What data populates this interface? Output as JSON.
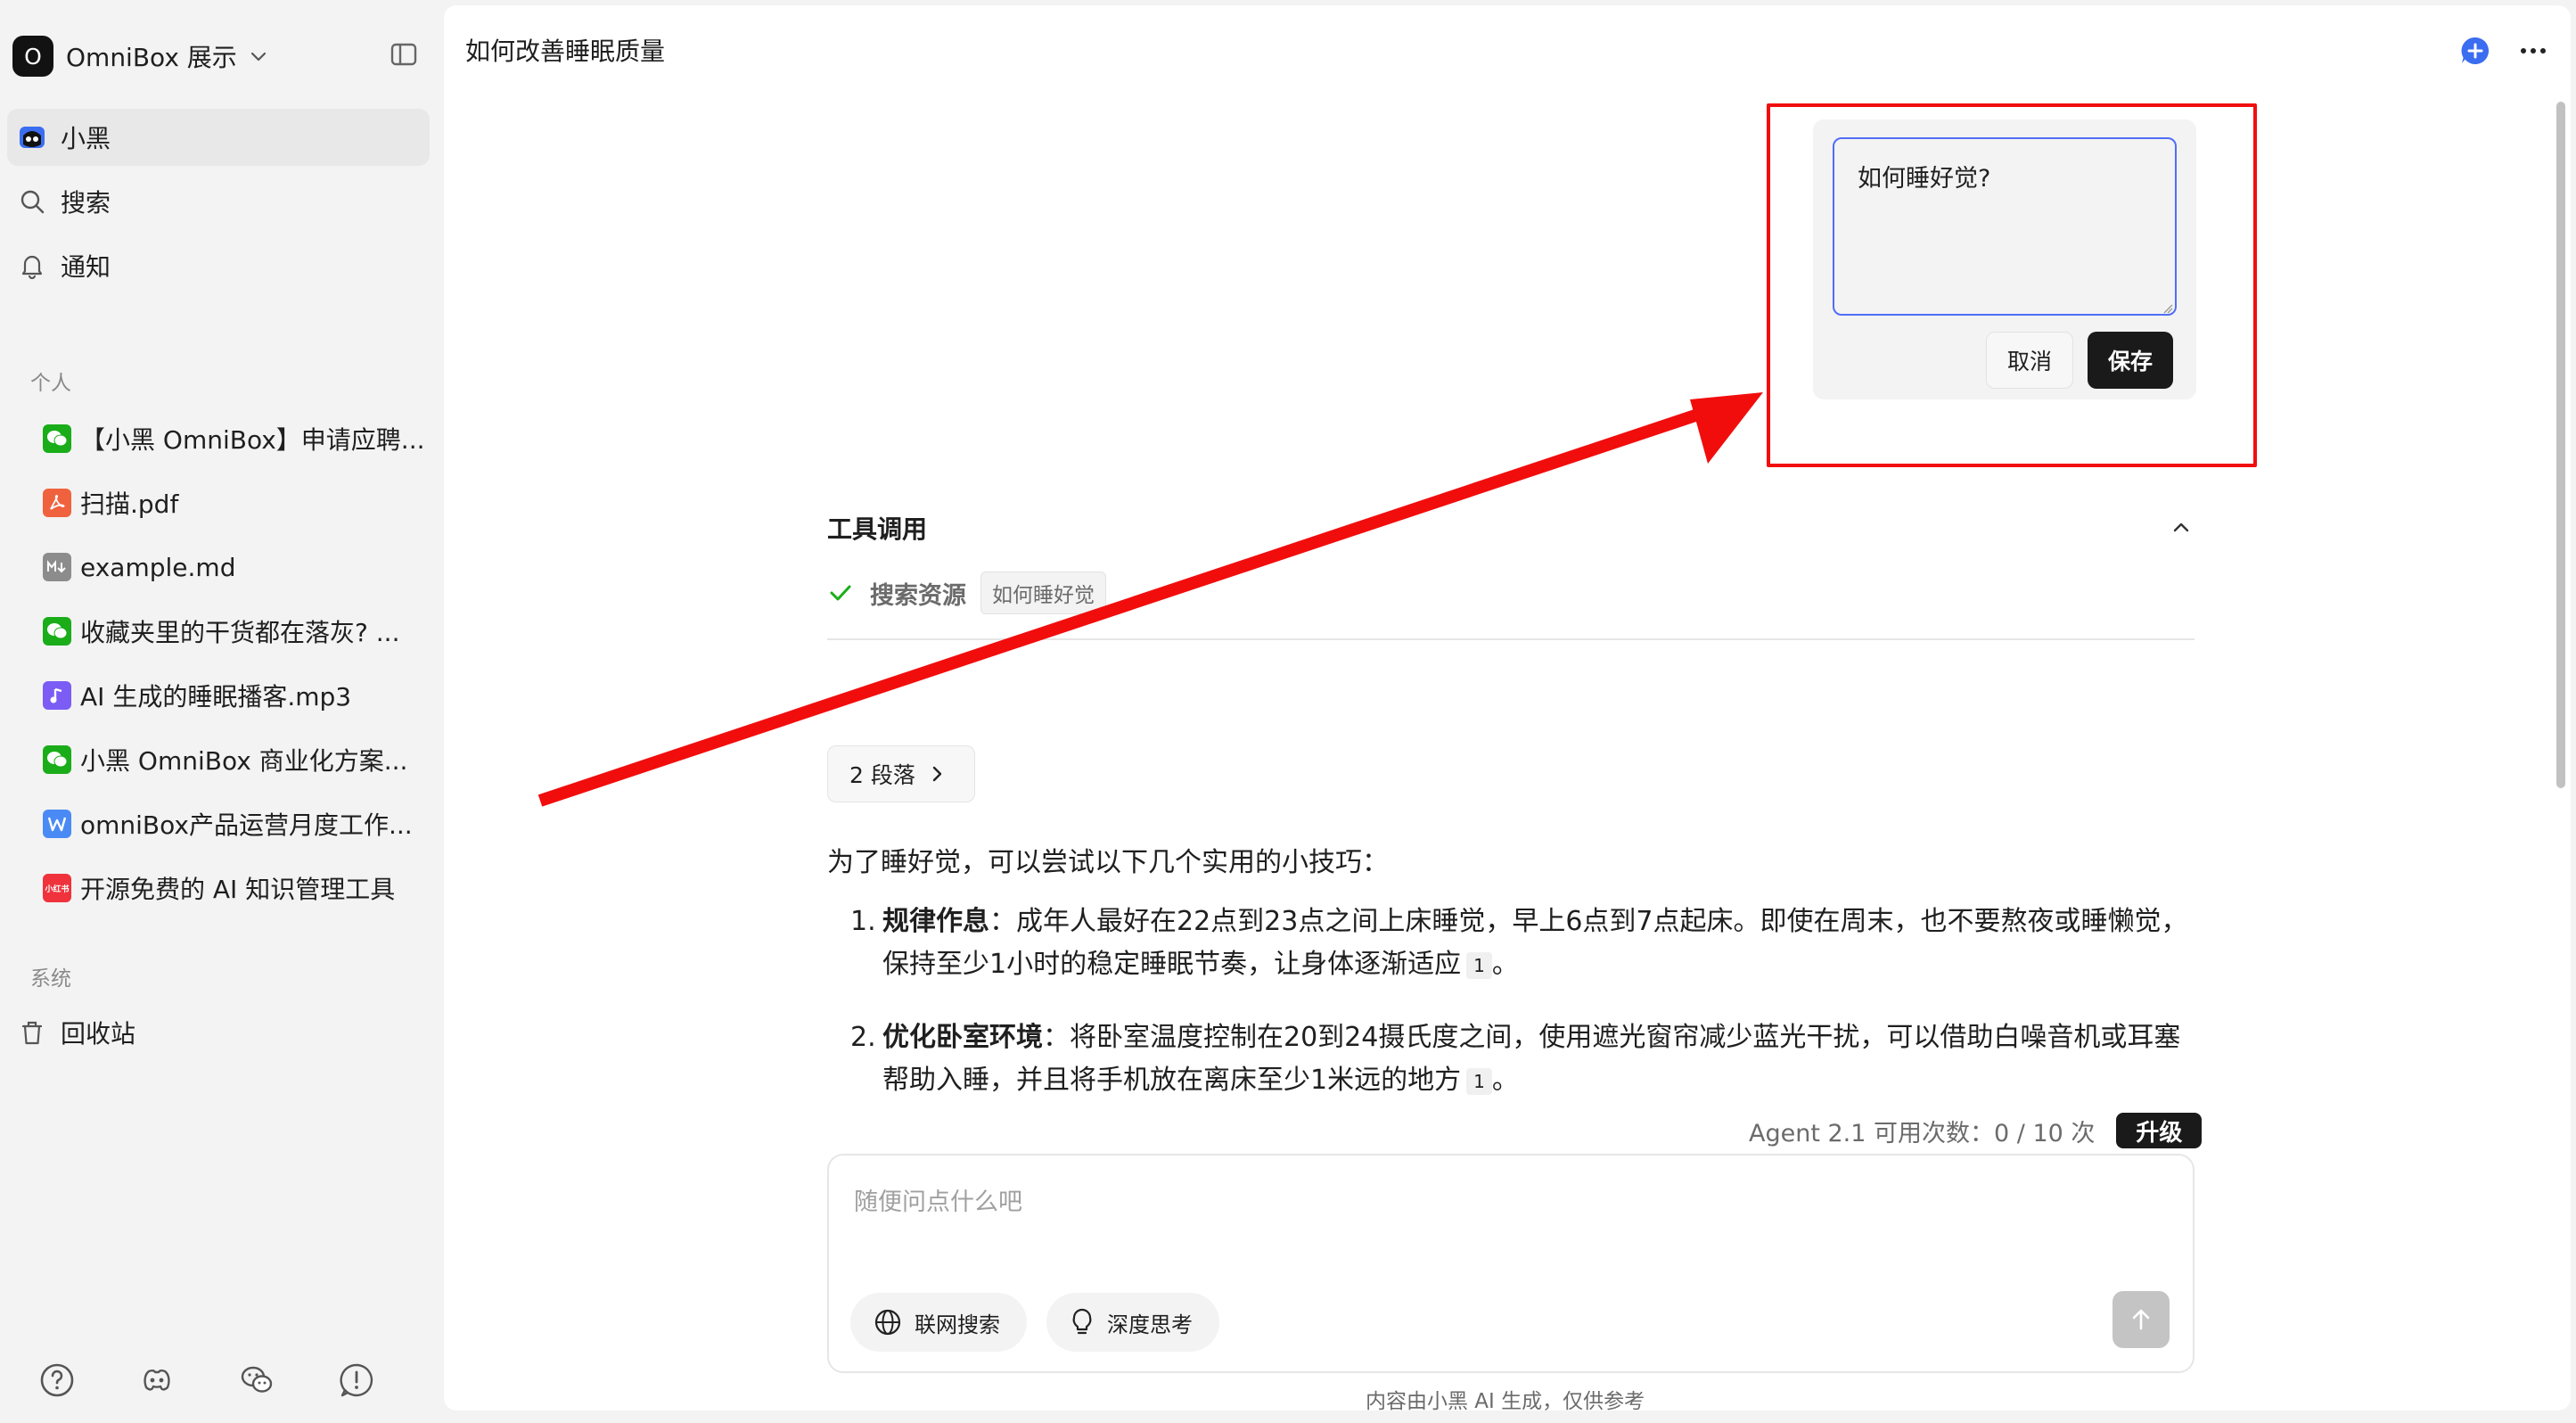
{
  "workspace": {
    "logo_letter": "O",
    "name": "OmniBox 展示"
  },
  "nav": [
    {
      "label": "小黑",
      "icon": "mascot-icon",
      "active": true
    },
    {
      "label": "搜索",
      "icon": "search-icon",
      "active": false
    },
    {
      "label": "通知",
      "icon": "bell-icon",
      "active": false
    }
  ],
  "sections": {
    "personal": "个人",
    "system": "系统"
  },
  "documents": [
    {
      "label": "【小黑 OmniBox】申请应聘...",
      "icon": "wechat-icon",
      "color": "#1aad19"
    },
    {
      "label": "扫描.pdf",
      "icon": "pdf-icon",
      "color": "#f0623e"
    },
    {
      "label": "example.md",
      "icon": "markdown-icon",
      "color": "#8c8c8c"
    },
    {
      "label": "收藏夹里的干货都在落灰? ...",
      "icon": "wechat-icon",
      "color": "#1aad19"
    },
    {
      "label": "AI 生成的睡眠播客.mp3",
      "icon": "audio-icon",
      "color": "#7b5cf5"
    },
    {
      "label": "小黑 OmniBox 商业化方案...",
      "icon": "wechat-icon",
      "color": "#1aad19"
    },
    {
      "label": "omniBox产品运营月度工作...",
      "icon": "word-icon",
      "color": "#4a8af4"
    },
    {
      "label": "开源免费的 AI 知识管理工具",
      "icon": "xiaohongshu-icon",
      "color": "#f0323c"
    }
  ],
  "system_items": [
    {
      "label": "回收站",
      "icon": "trash-icon"
    }
  ],
  "xiaohongshu_badge": "小红书",
  "main": {
    "title": "如何改善睡眠质量",
    "edit": {
      "value": "如何睡好觉?",
      "cancel_label": "取消",
      "save_label": "保存"
    },
    "tool_call": {
      "header": "工具调用",
      "tool_name": "搜索资源",
      "query": "如何睡好觉"
    },
    "paragraphs_button": "2 段落",
    "answer": {
      "intro": "为了睡好觉，可以尝试以下几个实用的小技巧：",
      "items": [
        {
          "num": "1.",
          "title": "规律作息",
          "text": "：成年人最好在22点到23点之间上床睡觉，早上6点到7点起床。即使在周末，也不要熬夜或睡懒觉，保持至少1小时的稳定睡眠节奏，让身体逐渐适应",
          "cite": "1",
          "end": "。"
        },
        {
          "num": "2.",
          "title": "优化卧室环境",
          "text": "：将卧室温度控制在20到24摄氏度之间，使用遮光窗帘减少蓝光干扰，可以借助白噪音机或耳塞帮助入睡，并且将手机放在离床至少1米远的地方",
          "cite": "1",
          "end": "。"
        }
      ]
    },
    "quota": {
      "text": "Agent 2.1 可用次数：0 / 10 次",
      "upgrade_label": "升级"
    },
    "composer": {
      "placeholder": "随便问点什么吧",
      "web_search_label": "联网搜索",
      "deep_think_label": "深度思考"
    },
    "disclaimer": "内容由小黑 AI 生成，仅供参考"
  },
  "colors": {
    "accent": "#4f6ef7",
    "annotation_red": "#f20d0d",
    "check_green": "#1aad19",
    "button_dark": "#1a1a1a"
  }
}
